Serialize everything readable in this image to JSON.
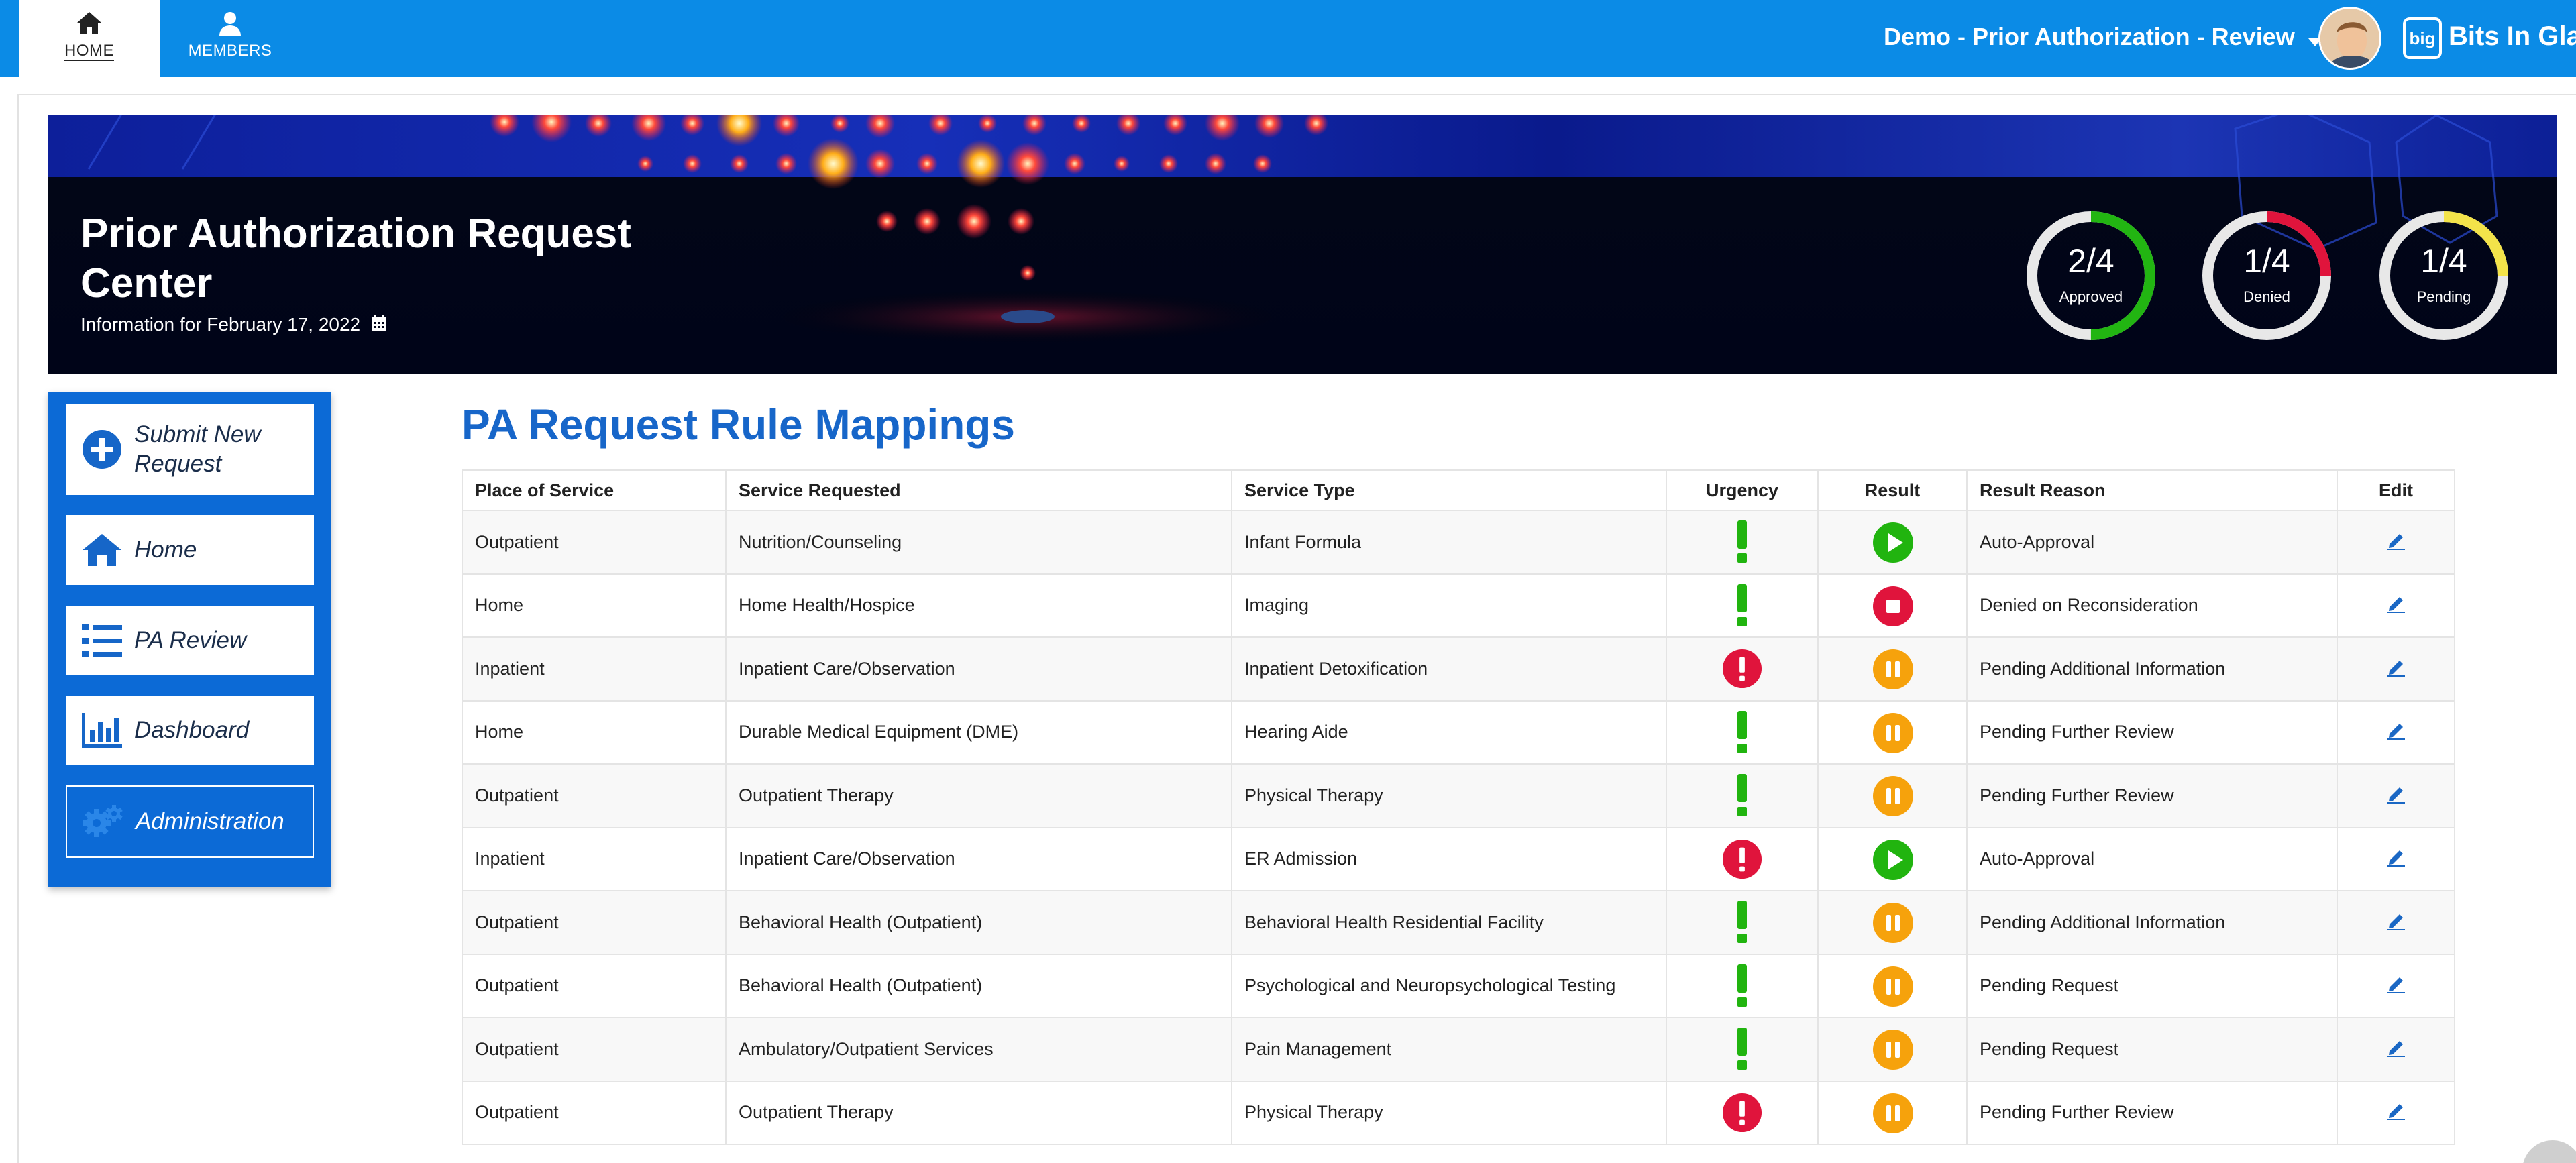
{
  "nav": {
    "tabs": [
      {
        "label": "HOME",
        "icon": "home-icon"
      },
      {
        "label": "MEMBERS",
        "icon": "user-icon"
      }
    ],
    "context_title": "Demo - Prior Authorization - Review",
    "brand_logo": "big",
    "brand_name": "Bits In Glass"
  },
  "hero": {
    "title": "Prior Authorization Request Center",
    "date": "Information for February 17, 2022",
    "stats": [
      {
        "value": "2/4",
        "label": "Approved",
        "fraction": 0.5,
        "color": "#22b512"
      },
      {
        "value": "1/4",
        "label": "Denied",
        "fraction": 0.25,
        "color": "#e0143c"
      },
      {
        "value": "1/4",
        "label": "Pending",
        "fraction": 0.25,
        "color": "#f3e34a"
      }
    ]
  },
  "sidebar": {
    "items": [
      {
        "label": "Submit New Request",
        "icon": "plus-circle-icon"
      },
      {
        "label": "Home",
        "icon": "home-icon"
      },
      {
        "label": "PA Review",
        "icon": "list-icon"
      },
      {
        "label": "Dashboard",
        "icon": "bar-chart-icon"
      },
      {
        "label": "Administration",
        "icon": "gears-icon"
      }
    ]
  },
  "main": {
    "title": "PA Request Rule Mappings",
    "columns": [
      "Place of Service",
      "Service Requested",
      "Service Type",
      "Urgency",
      "Result",
      "Result Reason",
      "Edit"
    ],
    "colors": {
      "green": "#21b40f",
      "red": "#e0143c",
      "orange": "#f6a20c",
      "pencil": "#1a67c4"
    },
    "rows": [
      {
        "place": "Outpatient",
        "requested": "Nutrition/Counseling",
        "type": "Infant Formula",
        "urgency": "normal",
        "result": "approved",
        "reason": "Auto-Approval"
      },
      {
        "place": "Home",
        "requested": "Home Health/Hospice",
        "type": "Imaging",
        "urgency": "normal",
        "result": "denied",
        "reason": "Denied on Reconsideration"
      },
      {
        "place": "Inpatient",
        "requested": "Inpatient Care/Observation",
        "type": "Inpatient Detoxification",
        "urgency": "urgent",
        "result": "pending",
        "reason": "Pending Additional Information"
      },
      {
        "place": "Home",
        "requested": "Durable Medical Equipment (DME)",
        "type": "Hearing Aide",
        "urgency": "normal",
        "result": "pending",
        "reason": "Pending Further Review"
      },
      {
        "place": "Outpatient",
        "requested": "Outpatient Therapy",
        "type": "Physical Therapy",
        "urgency": "normal",
        "result": "pending",
        "reason": "Pending Further Review"
      },
      {
        "place": "Inpatient",
        "requested": "Inpatient Care/Observation",
        "type": "ER Admission",
        "urgency": "urgent",
        "result": "approved",
        "reason": "Auto-Approval"
      },
      {
        "place": "Outpatient",
        "requested": "Behavioral Health (Outpatient)",
        "type": "Behavioral Health Residential Facility",
        "urgency": "normal",
        "result": "pending",
        "reason": "Pending Additional Information"
      },
      {
        "place": "Outpatient",
        "requested": "Behavioral Health (Outpatient)",
        "type": "Psychological and Neuropsychological Testing",
        "urgency": "normal",
        "result": "pending",
        "reason": "Pending Request"
      },
      {
        "place": "Outpatient",
        "requested": "Ambulatory/Outpatient Services",
        "type": "Pain Management",
        "urgency": "normal",
        "result": "pending",
        "reason": "Pending Request"
      },
      {
        "place": "Outpatient",
        "requested": "Outpatient Therapy",
        "type": "Physical Therapy",
        "urgency": "urgent",
        "result": "pending",
        "reason": "Pending Further Review"
      }
    ]
  }
}
